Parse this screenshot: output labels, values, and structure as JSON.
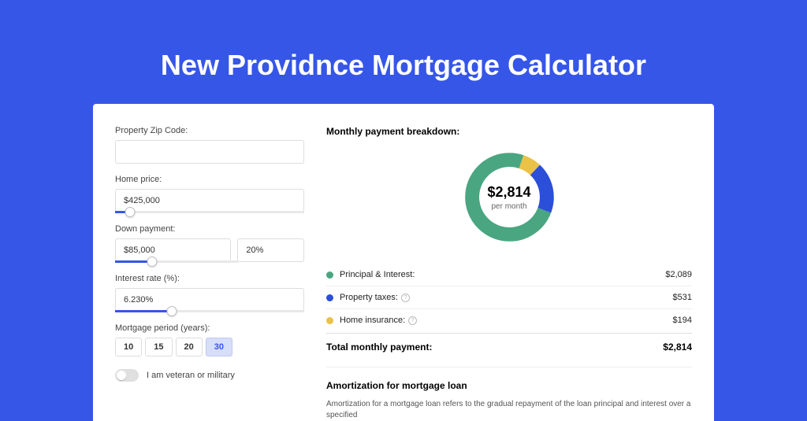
{
  "title": "New Providnce Mortgage Calculator",
  "form": {
    "zip_label": "Property Zip Code:",
    "zip_value": "",
    "home_price_label": "Home price:",
    "home_price_value": "$425,000",
    "down_payment_label": "Down payment:",
    "down_payment_value": "$85,000",
    "down_payment_pct": "20%",
    "interest_label": "Interest rate (%):",
    "interest_value": "6.230%",
    "period_label": "Mortgage period (years):",
    "periods": [
      "10",
      "15",
      "20",
      "30"
    ],
    "period_selected": "30",
    "veteran_label": "I am veteran or military"
  },
  "breakdown": {
    "title": "Monthly payment breakdown:",
    "center_amount": "$2,814",
    "center_sub": "per month",
    "items": [
      {
        "label": "Principal & Interest:",
        "value": "$2,089",
        "color": "#49a680",
        "show_info": false
      },
      {
        "label": "Property taxes:",
        "value": "$531",
        "color": "#2b4fd8",
        "show_info": true
      },
      {
        "label": "Home insurance:",
        "value": "$194",
        "color": "#eac248",
        "show_info": true
      }
    ],
    "total_label": "Total monthly payment:",
    "total_value": "$2,814"
  },
  "amortization": {
    "title": "Amortization for mortgage loan",
    "text": "Amortization for a mortgage loan refers to the gradual repayment of the loan principal and interest over a specified"
  },
  "chart_data": {
    "type": "pie",
    "title": "Monthly payment breakdown",
    "series": [
      {
        "name": "Principal & Interest",
        "value": 2089,
        "color": "#49a680"
      },
      {
        "name": "Property taxes",
        "value": 531,
        "color": "#2b4fd8"
      },
      {
        "name": "Home insurance",
        "value": 194,
        "color": "#eac248"
      }
    ],
    "total": 2814,
    "unit": "USD per month"
  },
  "sliders": {
    "home_price_pct": 8,
    "down_payment_pct": 20,
    "interest_pct": 30
  }
}
